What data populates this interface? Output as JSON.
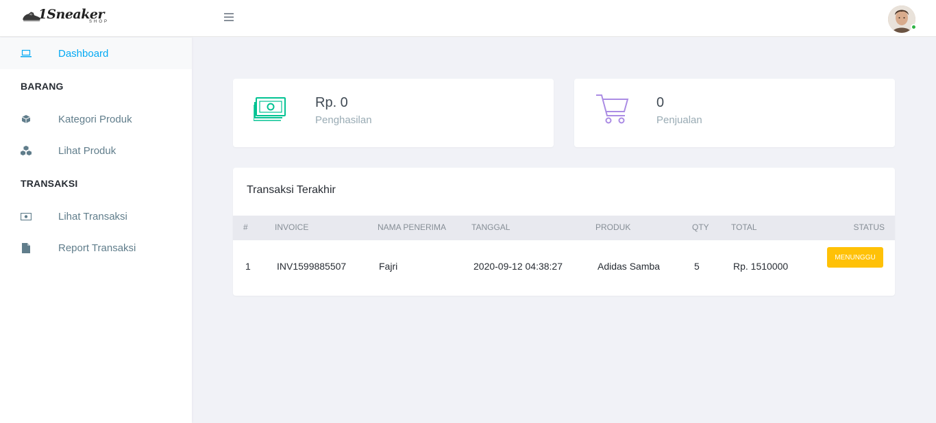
{
  "header": {
    "logo_text": "1Sneaker",
    "logo_sub": "SHOP"
  },
  "sidebar": {
    "items": [
      {
        "label": "Dashboard",
        "icon": "laptop-icon",
        "active": true
      },
      {
        "label": "Kategori Produk",
        "icon": "cube-icon"
      },
      {
        "label": "Lihat Produk",
        "icon": "cubes-icon"
      },
      {
        "label": "Lihat Transaksi",
        "icon": "money-icon"
      },
      {
        "label": "Report Transaksi",
        "icon": "file-icon"
      }
    ],
    "sections": [
      "BARANG",
      "TRANSAKSI"
    ]
  },
  "stats": {
    "income": {
      "value": "Rp. 0",
      "label": "Penghasilan",
      "icon": "money-stack-icon",
      "color": "#00c292"
    },
    "sales": {
      "value": "0",
      "label": "Penjualan",
      "icon": "cart-icon",
      "color": "#ab8ce4"
    }
  },
  "transactions": {
    "title": "Transaksi Terakhir",
    "columns": [
      "#",
      "INVOICE",
      "NAMA PENERIMA",
      "TANGGAL",
      "PRODUK",
      "QTY",
      "TOTAL",
      "STATUS"
    ],
    "rows": [
      {
        "no": "1",
        "invoice": "INV1599885507",
        "recipient": "Fajri",
        "date": "2020-09-12 04:38:27",
        "product": "Adidas Samba",
        "qty": "5",
        "total": "Rp. 1510000",
        "status": "MENUNGGU"
      }
    ]
  },
  "colors": {
    "accent": "#03a9f3",
    "badge_warning": "#ffc107",
    "online": "#2fb344"
  }
}
